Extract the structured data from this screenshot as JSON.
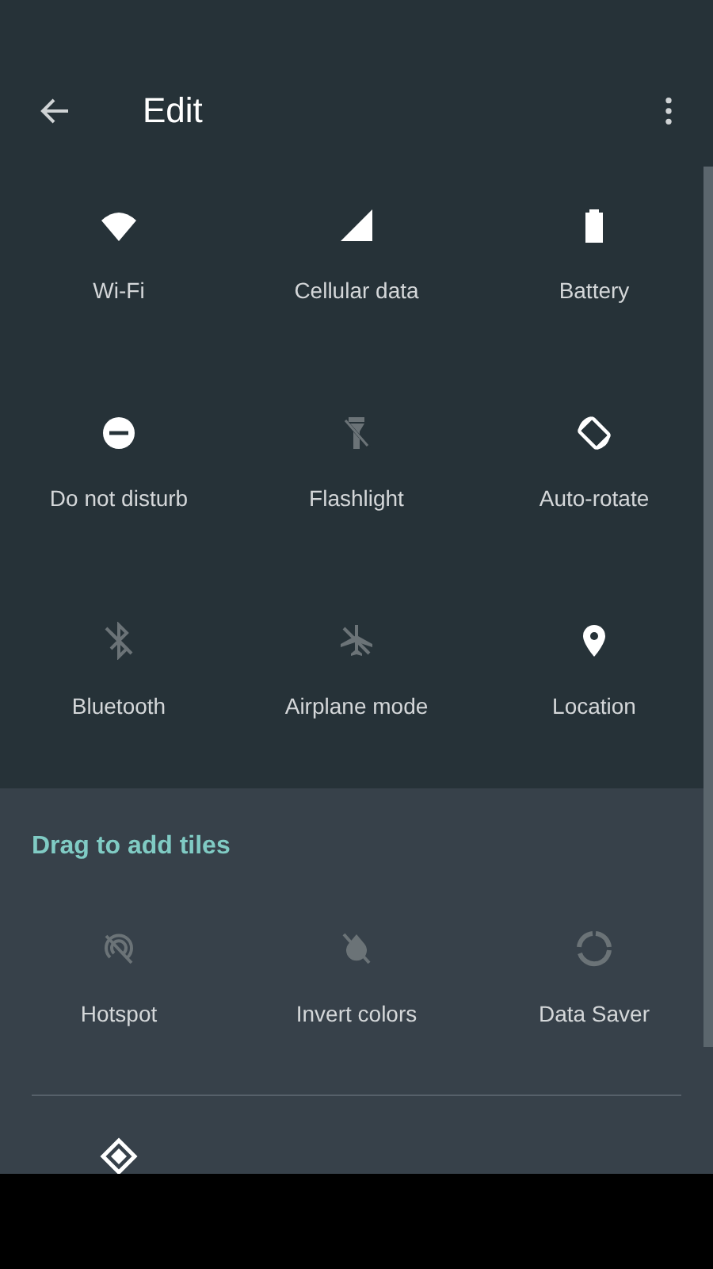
{
  "header": {
    "title": "Edit"
  },
  "tiles": [
    {
      "label": "Wi-Fi",
      "active": true
    },
    {
      "label": "Cellular data",
      "active": true
    },
    {
      "label": "Battery",
      "active": true
    },
    {
      "label": "Do not disturb",
      "active": true
    },
    {
      "label": "Flashlight",
      "active": false
    },
    {
      "label": "Auto-rotate",
      "active": true
    },
    {
      "label": "Bluetooth",
      "active": false
    },
    {
      "label": "Airplane mode",
      "active": false
    },
    {
      "label": "Location",
      "active": true
    }
  ],
  "add_section": {
    "title": "Drag to add tiles",
    "tiles": [
      {
        "label": "Hotspot",
        "active": false
      },
      {
        "label": "Invert colors",
        "active": false
      },
      {
        "label": "Data Saver",
        "active": false
      }
    ],
    "partial_tiles": [
      {
        "active": true
      }
    ]
  }
}
